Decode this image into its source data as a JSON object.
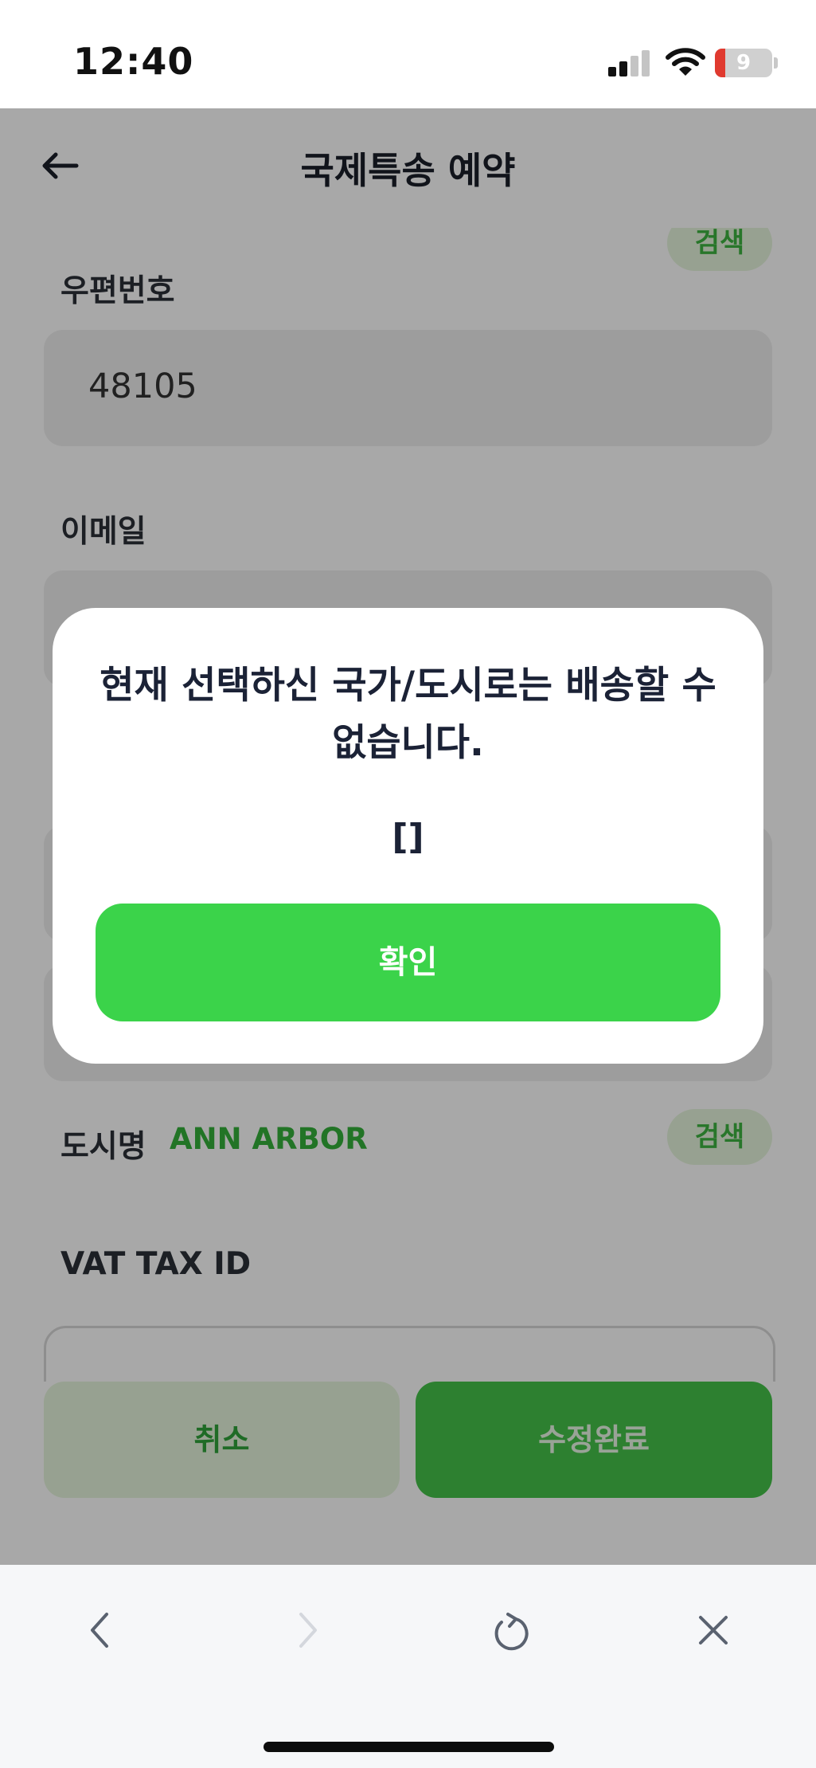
{
  "status_bar": {
    "time": "12:40",
    "battery_level": "9"
  },
  "header": {
    "title": "국제특송 예약"
  },
  "form": {
    "top_search_label": "검색",
    "postal_code_label": "우편번호",
    "postal_code_value": "48105",
    "email_label": "이메일",
    "city_label": "도시명",
    "city_value": "ANN ARBOR",
    "city_search_label": "검색",
    "vat_label": "VAT TAX ID"
  },
  "actions": {
    "cancel_label": "취소",
    "save_label": "수정완료"
  },
  "modal": {
    "message": "현재 선택하신 국가/도시로는 배송할 수 없습니다.",
    "detail": "[]",
    "confirm_label": "확인"
  },
  "colors": {
    "accent_green": "#3bd34a",
    "light_green": "#e6f4dc",
    "battery_low": "#e03a2f"
  },
  "icons": {
    "back": "arrow-left-icon",
    "browser_back": "chevron-left-icon",
    "browser_forward": "chevron-right-icon",
    "reload": "reload-icon",
    "close": "close-icon"
  }
}
